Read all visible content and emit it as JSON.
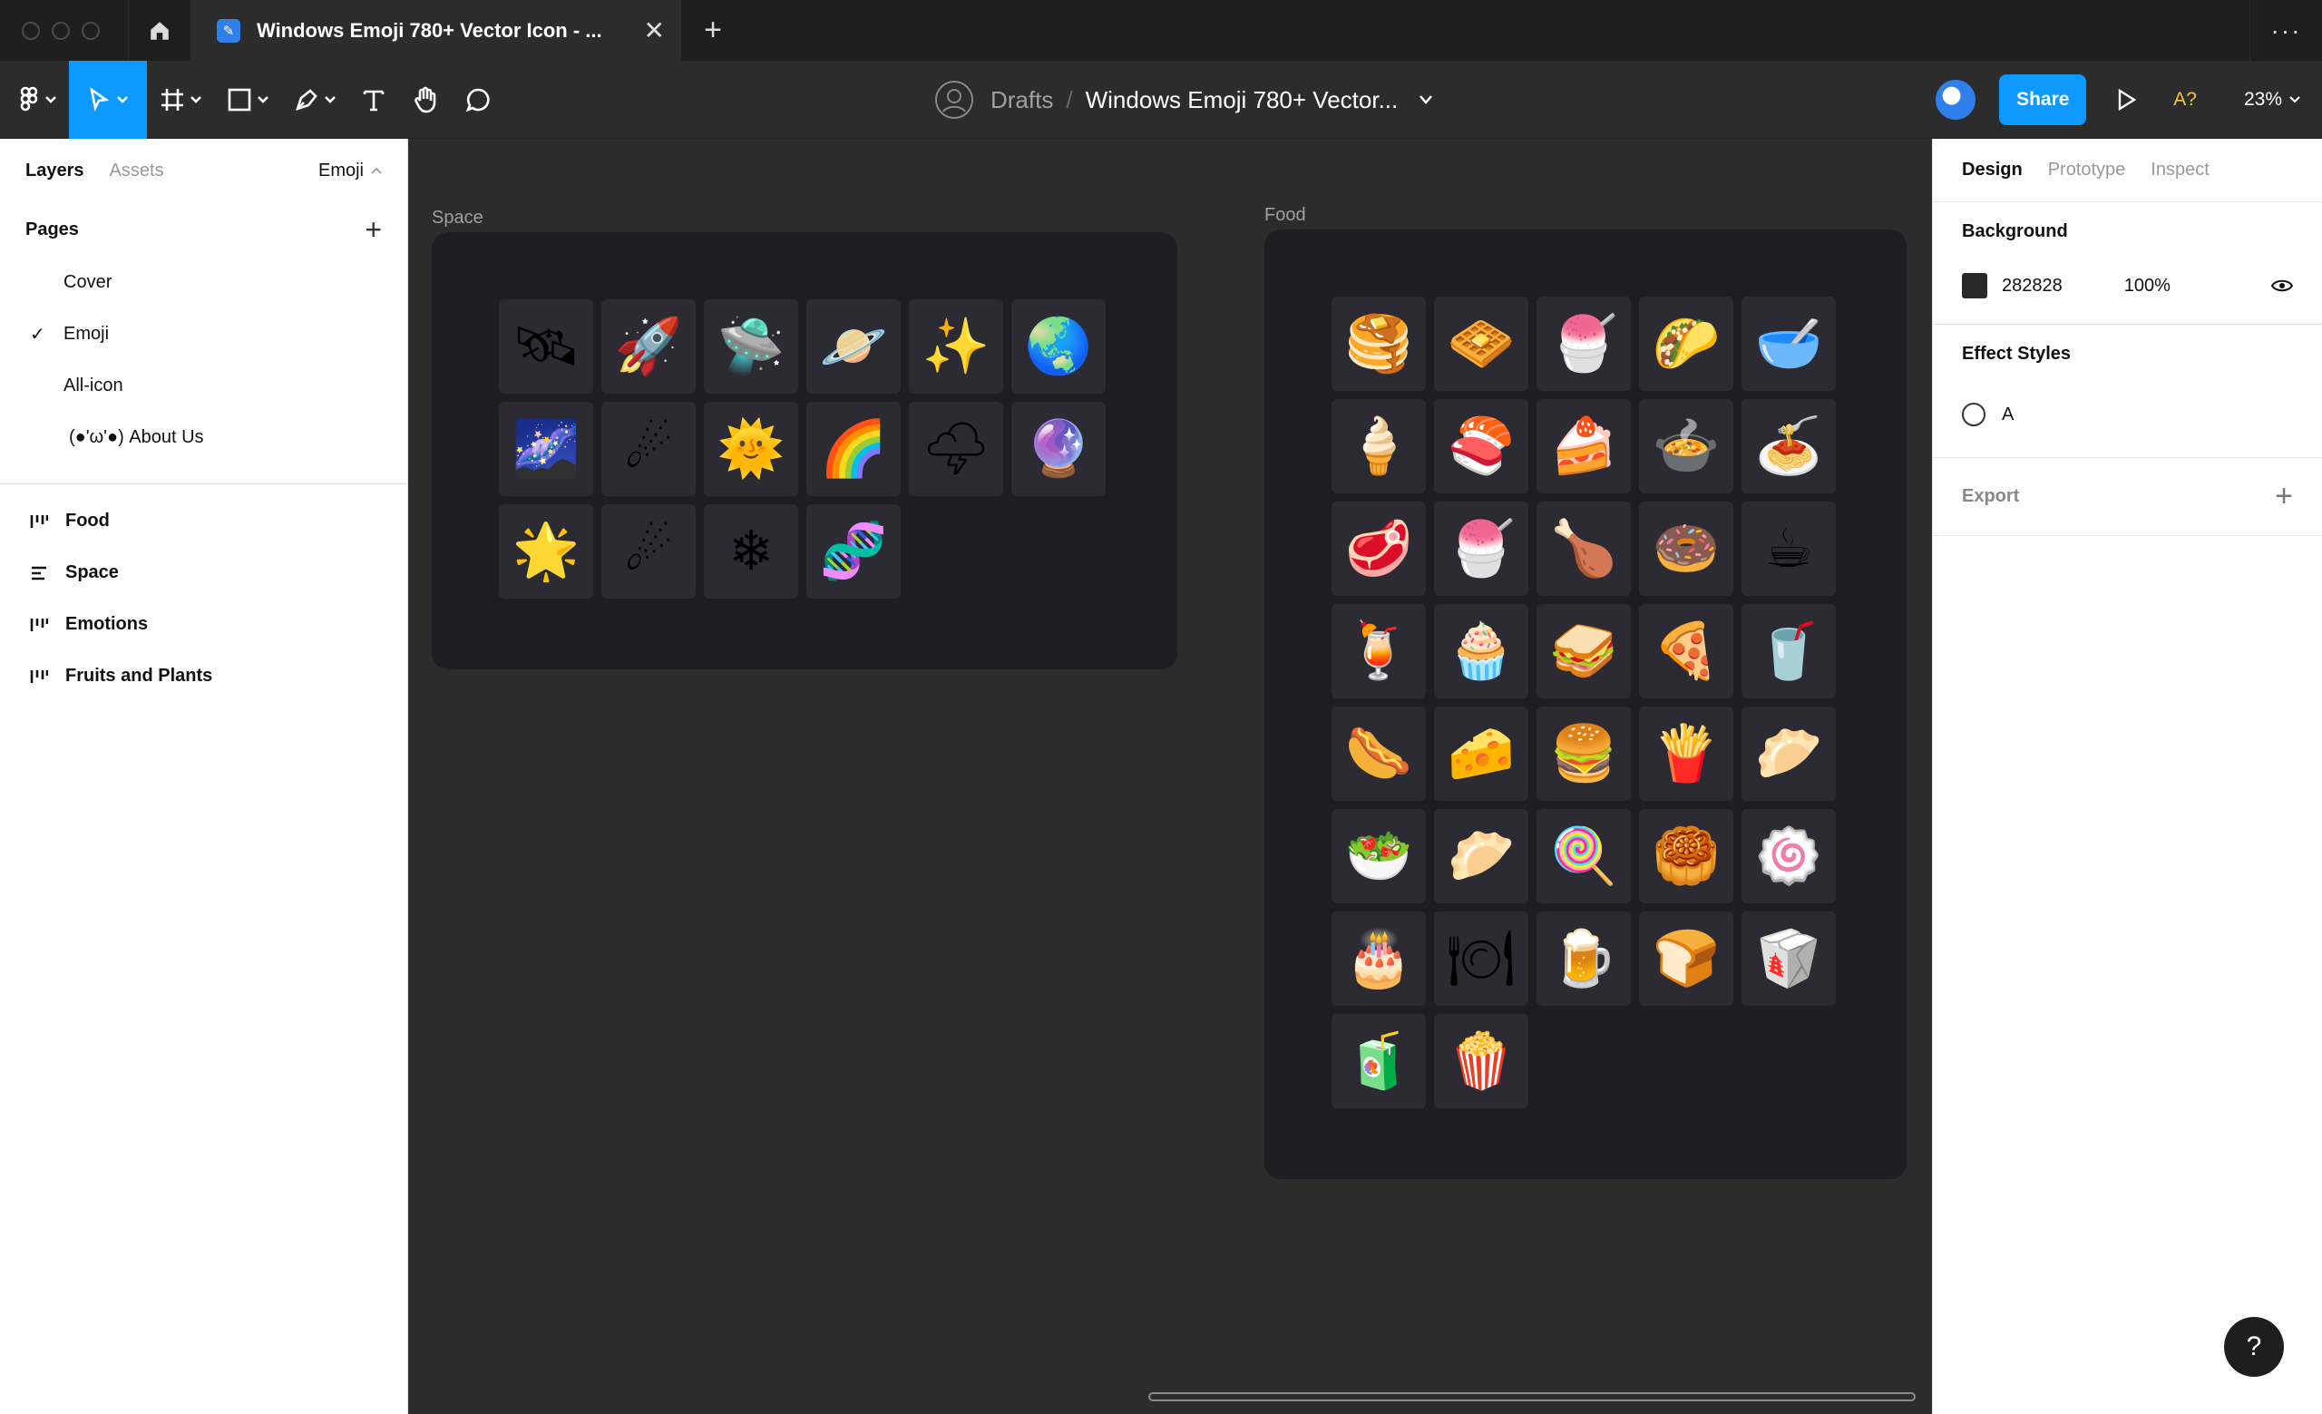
{
  "titlebar": {
    "tab_title": "Windows Emoji 780+ Vector Icon - ...",
    "close_glyph": "✕",
    "new_tab_glyph": "+",
    "more_glyph": "···"
  },
  "toolbar": {
    "breadcrumb_root": "Drafts",
    "breadcrumb_sep": "/",
    "file_name": "Windows Emoji 780+ Vector...",
    "share_label": "Share",
    "a11y_label": "A?",
    "zoom": "23%"
  },
  "left_panel": {
    "tabs": [
      "Layers",
      "Assets"
    ],
    "page_picker": "Emoji",
    "pages_title": "Pages",
    "pages": [
      {
        "label": "Cover",
        "checked": false
      },
      {
        "label": "Emoji",
        "checked": true
      },
      {
        "label": "All-icon",
        "checked": false
      },
      {
        "label": "(●'ω'●)  About Us",
        "checked": false
      }
    ],
    "layers": [
      {
        "label": "Food",
        "icon": "column-layout-icon"
      },
      {
        "label": "Space",
        "icon": "row-layout-icon"
      },
      {
        "label": "Emotions",
        "icon": "column-layout-icon"
      },
      {
        "label": "Fruits and Plants",
        "icon": "column-layout-icon"
      }
    ]
  },
  "canvas": {
    "frames": [
      {
        "label": "Space",
        "emoji": [
          "🛰",
          "🚀",
          "🛸",
          "🪐",
          "✨",
          "🌏",
          "🌌",
          "☄",
          "🌞",
          "🌈",
          "🌩",
          "🔮",
          "🌟",
          "☄",
          "❄",
          "🧬"
        ]
      },
      {
        "label": "Food",
        "emoji": [
          "🥞",
          "🧇",
          "🍧",
          "🌮",
          "🥣",
          "🍦",
          "🍣",
          "🍰",
          "🍲",
          "🍝",
          "🥩",
          "🍧",
          "🍗",
          "🍩",
          "☕",
          "🍹",
          "🧁",
          "🥪",
          "🍕",
          "🥤",
          "🌭",
          "🧀",
          "🍔",
          "🍟",
          "🥟",
          "🥗",
          "🥟",
          "🍭",
          "🥮",
          "🍥",
          "🎂",
          "🍽",
          "🍺",
          "🍞",
          "🥡",
          "🧃",
          "🍿"
        ]
      }
    ]
  },
  "right_panel": {
    "tabs": [
      "Design",
      "Prototype",
      "Inspect"
    ],
    "background_title": "Background",
    "background_hex": "282828",
    "background_opacity": "100%",
    "background_color": "#282828",
    "effect_title": "Effect Styles",
    "effect_name": "A",
    "export_title": "Export",
    "export_plus": "+"
  },
  "help_glyph": "?"
}
